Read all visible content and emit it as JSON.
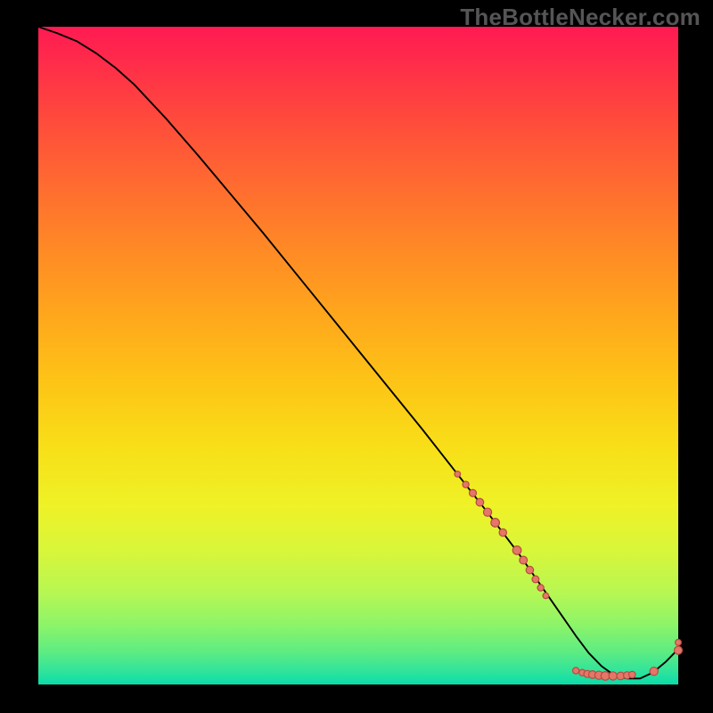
{
  "watermark": "TheBottleNecker.com",
  "colors": {
    "dot_fill": "#e5766a",
    "dot_stroke": "#b74c3f",
    "curve": "#000000",
    "frame_bg": "#000000"
  },
  "chart_data": {
    "type": "line",
    "title": "",
    "xlabel": "",
    "ylabel": "",
    "xlim": [
      0,
      100
    ],
    "ylim": [
      0,
      100
    ],
    "series": [
      {
        "name": "bottleneck-curve",
        "x": [
          0,
          3,
          6,
          9,
          12,
          15,
          20,
          25,
          30,
          35,
          40,
          45,
          50,
          55,
          60,
          65,
          70,
          75,
          80,
          82,
          84,
          86,
          88,
          90,
          92,
          94,
          96,
          98,
          100
        ],
        "y": [
          100,
          99,
          97.8,
          96,
          93.8,
          91.2,
          86,
          80.4,
          74.6,
          68.8,
          62.8,
          56.8,
          50.8,
          44.8,
          38.8,
          32.6,
          26.4,
          20.0,
          13.0,
          10.2,
          7.4,
          4.8,
          2.8,
          1.4,
          0.9,
          0.9,
          1.8,
          3.4,
          5.4
        ]
      }
    ],
    "scatter": [
      {
        "name": "cluster-dots",
        "points": [
          {
            "x": 65.5,
            "y": 32.0,
            "r": 3.3
          },
          {
            "x": 66.8,
            "y": 30.4,
            "r": 3.6
          },
          {
            "x": 67.9,
            "y": 29.1,
            "r": 4.0
          },
          {
            "x": 69.0,
            "y": 27.7,
            "r": 4.3
          },
          {
            "x": 70.2,
            "y": 26.2,
            "r": 4.6
          },
          {
            "x": 71.4,
            "y": 24.6,
            "r": 4.8
          },
          {
            "x": 72.6,
            "y": 23.1,
            "r": 4.2
          },
          {
            "x": 74.8,
            "y": 20.4,
            "r": 4.8
          },
          {
            "x": 75.8,
            "y": 18.9,
            "r": 4.4
          },
          {
            "x": 76.8,
            "y": 17.4,
            "r": 4.2
          },
          {
            "x": 77.7,
            "y": 16.0,
            "r": 3.9
          },
          {
            "x": 78.5,
            "y": 14.7,
            "r": 3.6
          },
          {
            "x": 79.3,
            "y": 13.5,
            "r": 3.3
          },
          {
            "x": 84.0,
            "y": 2.1,
            "r": 3.6
          },
          {
            "x": 85.0,
            "y": 1.8,
            "r": 3.6
          },
          {
            "x": 85.8,
            "y": 1.6,
            "r": 4.0
          },
          {
            "x": 86.6,
            "y": 1.5,
            "r": 4.3
          },
          {
            "x": 87.6,
            "y": 1.4,
            "r": 4.6
          },
          {
            "x": 88.6,
            "y": 1.3,
            "r": 4.8
          },
          {
            "x": 89.8,
            "y": 1.3,
            "r": 4.6
          },
          {
            "x": 91.0,
            "y": 1.3,
            "r": 4.3
          },
          {
            "x": 92.0,
            "y": 1.4,
            "r": 4.0
          },
          {
            "x": 92.8,
            "y": 1.5,
            "r": 3.7
          },
          {
            "x": 96.2,
            "y": 2.0,
            "r": 4.6
          },
          {
            "x": 100.0,
            "y": 5.2,
            "r": 4.5
          },
          {
            "x": 100.0,
            "y": 6.4,
            "r": 3.4
          }
        ]
      }
    ]
  }
}
